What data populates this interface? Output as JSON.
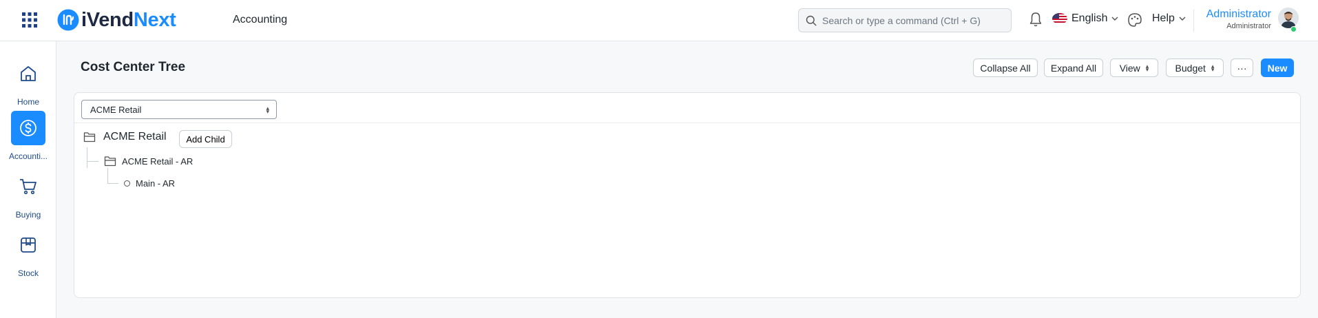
{
  "navbar": {
    "brand_part1": "iVend",
    "brand_part2": "Next",
    "module": "Accounting",
    "search_placeholder": "Search or type a command (Ctrl + G)",
    "language": "English",
    "help": "Help",
    "user_name": "Administrator",
    "user_role": "Administrator"
  },
  "sidebar": {
    "items": [
      {
        "label": "Home",
        "icon": "home-icon"
      },
      {
        "label": "Accounti...",
        "icon": "dollar-circle-icon",
        "active": true
      },
      {
        "label": "Buying",
        "icon": "cart-icon"
      },
      {
        "label": "Stock",
        "icon": "box-icon"
      }
    ]
  },
  "page": {
    "title": "Cost Center Tree",
    "buttons": {
      "collapse_all": "Collapse All",
      "expand_all": "Expand All",
      "view": "View",
      "budget": "Budget",
      "more": "···",
      "new": "New"
    }
  },
  "tree": {
    "company": "ACME Retail",
    "root": "ACME Retail",
    "add_child": "Add Child",
    "children": [
      {
        "label": "ACME Retail - AR",
        "type": "group"
      },
      {
        "label": "Main - AR",
        "type": "leaf"
      }
    ]
  },
  "colors": {
    "accent": "#1a8cff",
    "brand_dark": "#1e2a44",
    "online": "#2ecc71"
  }
}
